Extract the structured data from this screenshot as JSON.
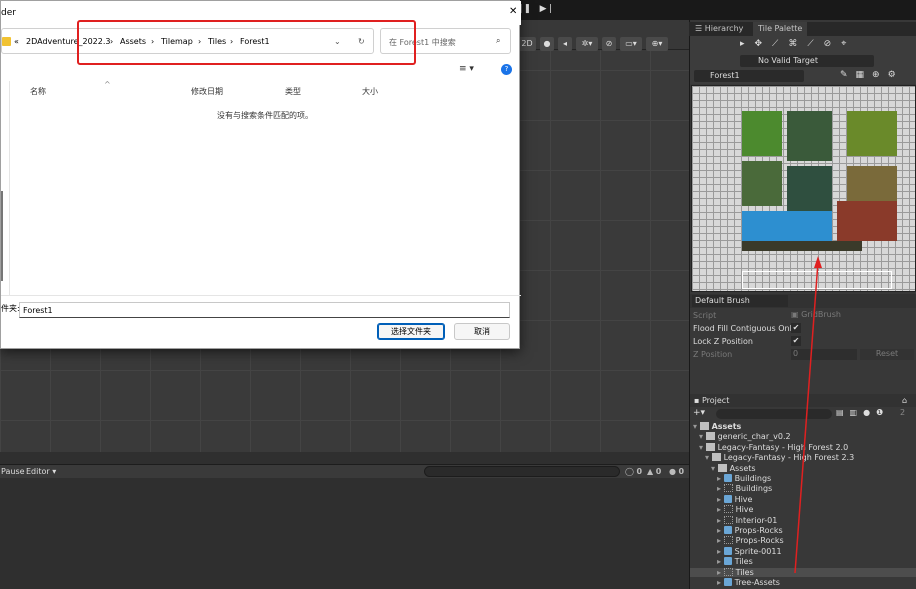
{
  "dialog": {
    "title_fragment": "der",
    "close_glyph": "✕",
    "breadcrumb": [
      "2DAdventure_2022.3",
      "Assets",
      "Tilemap",
      "Tiles",
      "Forest1"
    ],
    "breadcrumb_prefix": "«",
    "separator": "›",
    "search_placeholder": "在 Forest1 中搜索",
    "columns": {
      "name": "名称",
      "modified": "修改日期",
      "type": "类型",
      "size": "大小"
    },
    "empty_message": "没有与搜索条件匹配的项。",
    "folder_label": "件夹:",
    "folder_value": "Forest1",
    "select_button": "选择文件夹",
    "cancel_button": "取消"
  },
  "unity": {
    "scene_mode": "2D",
    "console": {
      "pause": "Pause",
      "editor": "Editor ▾",
      "err_count": "0",
      "warn_count": "0",
      "info_count": "0"
    },
    "tabs": {
      "hierarchy": "Hierarchy",
      "tile_palette": "Tile Palette"
    },
    "palette": {
      "target": "No Valid Target",
      "name": "Forest1"
    },
    "brush": {
      "name": "Default Brush",
      "script_label": "Script",
      "script_value": "GridBrush",
      "flood_label": "Flood Fill Contiguous Only",
      "lockz_label": "Lock Z Position",
      "zpos_label": "Z Position",
      "zpos_value": "0",
      "reset": "Reset"
    },
    "project": {
      "title": "Project",
      "badge": "2",
      "tree": [
        {
          "label": "Assets",
          "indent": 0,
          "kind": "folder",
          "bold": true
        },
        {
          "label": "generic_char_v0.2",
          "indent": 1,
          "kind": "folder"
        },
        {
          "label": "Legacy-Fantasy - High Forest 2.0",
          "indent": 1,
          "kind": "folder"
        },
        {
          "label": "Legacy-Fantasy - High Forest 2.3",
          "indent": 2,
          "kind": "folder"
        },
        {
          "label": "Assets",
          "indent": 3,
          "kind": "folder"
        },
        {
          "label": "Buildings",
          "indent": 4,
          "kind": "prefab"
        },
        {
          "label": "Buildings",
          "indent": 4,
          "kind": "sprite"
        },
        {
          "label": "Hive",
          "indent": 4,
          "kind": "prefab"
        },
        {
          "label": "Hive",
          "indent": 4,
          "kind": "sprite"
        },
        {
          "label": "Interior-01",
          "indent": 4,
          "kind": "sprite"
        },
        {
          "label": "Props-Rocks",
          "indent": 4,
          "kind": "prefab"
        },
        {
          "label": "Props-Rocks",
          "indent": 4,
          "kind": "sprite"
        },
        {
          "label": "Sprite-0011",
          "indent": 4,
          "kind": "prefab"
        },
        {
          "label": "Tiles",
          "indent": 4,
          "kind": "prefab"
        },
        {
          "label": "Tiles",
          "indent": 4,
          "kind": "sprite",
          "selected": true
        },
        {
          "label": "Tree-Assets",
          "indent": 4,
          "kind": "prefab"
        }
      ]
    }
  },
  "colors": {
    "annotation": "#e02020",
    "selected_button": "#005fb8"
  }
}
